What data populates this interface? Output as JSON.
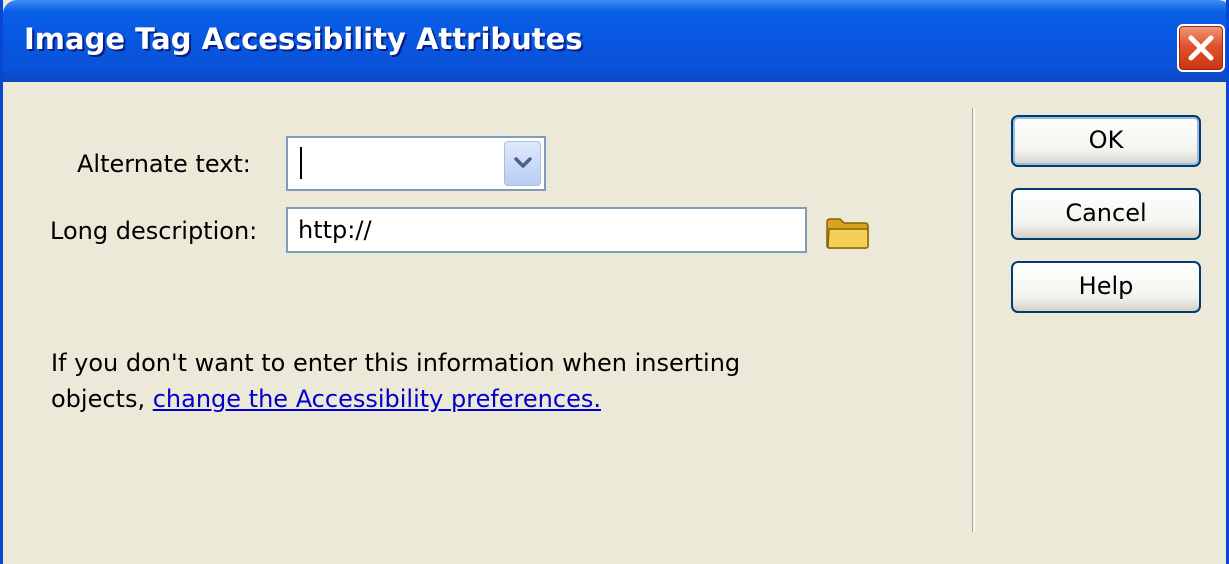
{
  "window": {
    "title": "Image Tag Accessibility Attributes"
  },
  "form": {
    "alt_text": {
      "label": "Alternate text:",
      "value": ""
    },
    "long_desc": {
      "label": "Long description:",
      "value": "http://"
    }
  },
  "note": {
    "line1": "If you don't want to enter this information when inserting",
    "line2_prefix": "objects, ",
    "link": "change the Accessibility preferences."
  },
  "buttons": {
    "ok": "OK",
    "cancel": "Cancel",
    "help": "Help"
  },
  "icons": {
    "close": "close-icon",
    "dropdown": "chevron-down-icon",
    "browse": "folder-icon"
  },
  "colors": {
    "titlebar": "#0a5fe6",
    "close": "#e0522c",
    "link": "#0000cc",
    "dialog_bg": "#ece9d8"
  }
}
